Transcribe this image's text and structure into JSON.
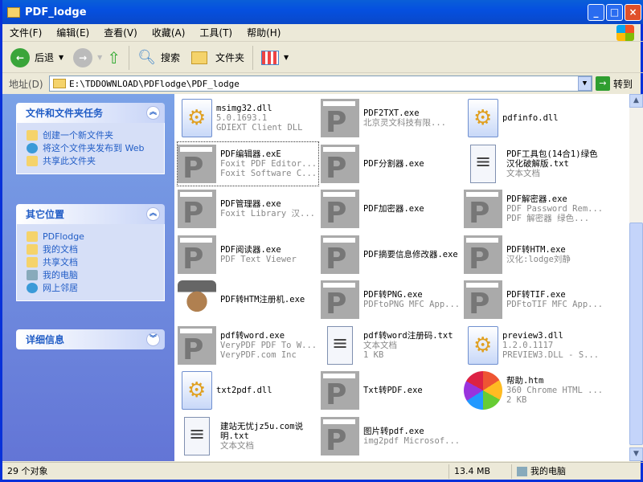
{
  "window": {
    "title": "PDF_lodge",
    "min": "_",
    "max": "□",
    "close": "×"
  },
  "menu": [
    "文件(F)",
    "编辑(E)",
    "查看(V)",
    "收藏(A)",
    "工具(T)",
    "帮助(H)"
  ],
  "toolbar": {
    "back": "后退",
    "search": "搜索",
    "folders": "文件夹"
  },
  "address": {
    "label": "地址(D)",
    "value": "E:\\TDDOWNLOAD\\PDFlodge\\PDF_lodge",
    "go": "转到"
  },
  "left": {
    "tasks": {
      "title": "文件和文件夹任务",
      "items": [
        "创建一个新文件夹",
        "将这个文件夹发布到 Web",
        "共享此文件夹"
      ]
    },
    "places": {
      "title": "其它位置",
      "items": [
        "PDFlodge",
        "我的文档",
        "共享文档",
        "我的电脑",
        "网上邻居"
      ]
    },
    "details": {
      "title": "详细信息"
    }
  },
  "files": [
    {
      "name": "msimg32.dll",
      "sub": [
        "5.0.1693.1",
        "GDIEXT Client DLL"
      ],
      "icon": "dll"
    },
    {
      "name": "PDF2TXT.exe",
      "sub": [
        "北京灵文科技有限..."
      ],
      "icon": "pdf"
    },
    {
      "name": "pdfinfo.dll",
      "sub": [],
      "icon": "dll"
    },
    {
      "name": "PDF编辑器.exE",
      "sub": [
        "Foxit PDF Editor...",
        "Foxit Software C..."
      ],
      "icon": "pdf"
    },
    {
      "name": "PDF分割器.exe",
      "sub": [],
      "icon": "pdf"
    },
    {
      "name": "PDF工具包(14合1)绿色汉化破解版.txt",
      "sub": [
        "文本文档"
      ],
      "icon": "txt"
    },
    {
      "name": "PDF管理器.exe",
      "sub": [
        "Foxit Library 汉..."
      ],
      "icon": "pdf"
    },
    {
      "name": "PDF加密器.exe",
      "sub": [],
      "icon": "pdf"
    },
    {
      "name": "PDF解密器.exe",
      "sub": [
        "PDF Password Rem...",
        "PDF 解密器 绿色..."
      ],
      "icon": "pdf"
    },
    {
      "name": "PDF阅读器.exe",
      "sub": [
        "PDF Text Viewer"
      ],
      "icon": "pdf"
    },
    {
      "name": "PDF摘要信息修改器.exe",
      "sub": [],
      "icon": "pdf"
    },
    {
      "name": "PDF转HTM.exe",
      "sub": [
        "汉化:lodge刘静"
      ],
      "icon": "pdf"
    },
    {
      "name": "PDF转HTM注册机.exe",
      "sub": [],
      "icon": "man"
    },
    {
      "name": "PDF转PNG.exe",
      "sub": [
        "PDFtoPNG MFC App..."
      ],
      "icon": "pdf"
    },
    {
      "name": "PDF转TIF.exe",
      "sub": [
        "PDFtoTIF MFC App..."
      ],
      "icon": "pdf"
    },
    {
      "name": "pdf转word.exe",
      "sub": [
        "VeryPDF PDF To W...",
        "VeryPDF.com Inc"
      ],
      "icon": "pdf"
    },
    {
      "name": "pdf转word注册码.txt",
      "sub": [
        "文本文档",
        "1 KB"
      ],
      "icon": "txt"
    },
    {
      "name": "preview3.dll",
      "sub": [
        "1.2.0.1117",
        "PREVIEW3.DLL - S..."
      ],
      "icon": "dll"
    },
    {
      "name": "txt2pdf.dll",
      "sub": [],
      "icon": "dll"
    },
    {
      "name": "Txt转PDF.exe",
      "sub": [],
      "icon": "pdf"
    },
    {
      "name": "帮助.htm",
      "sub": [
        "360 Chrome HTML ...",
        "2 KB"
      ],
      "icon": "360"
    },
    {
      "name": "建站无忧jz5u.com说明.txt",
      "sub": [
        "文本文档"
      ],
      "icon": "txt"
    },
    {
      "name": "图片转pdf.exe",
      "sub": [
        "img2pdf Microsof..."
      ],
      "icon": "pdf"
    }
  ],
  "status": {
    "count": "29 个对象",
    "size": "13.4 MB",
    "location": "我的电脑"
  }
}
